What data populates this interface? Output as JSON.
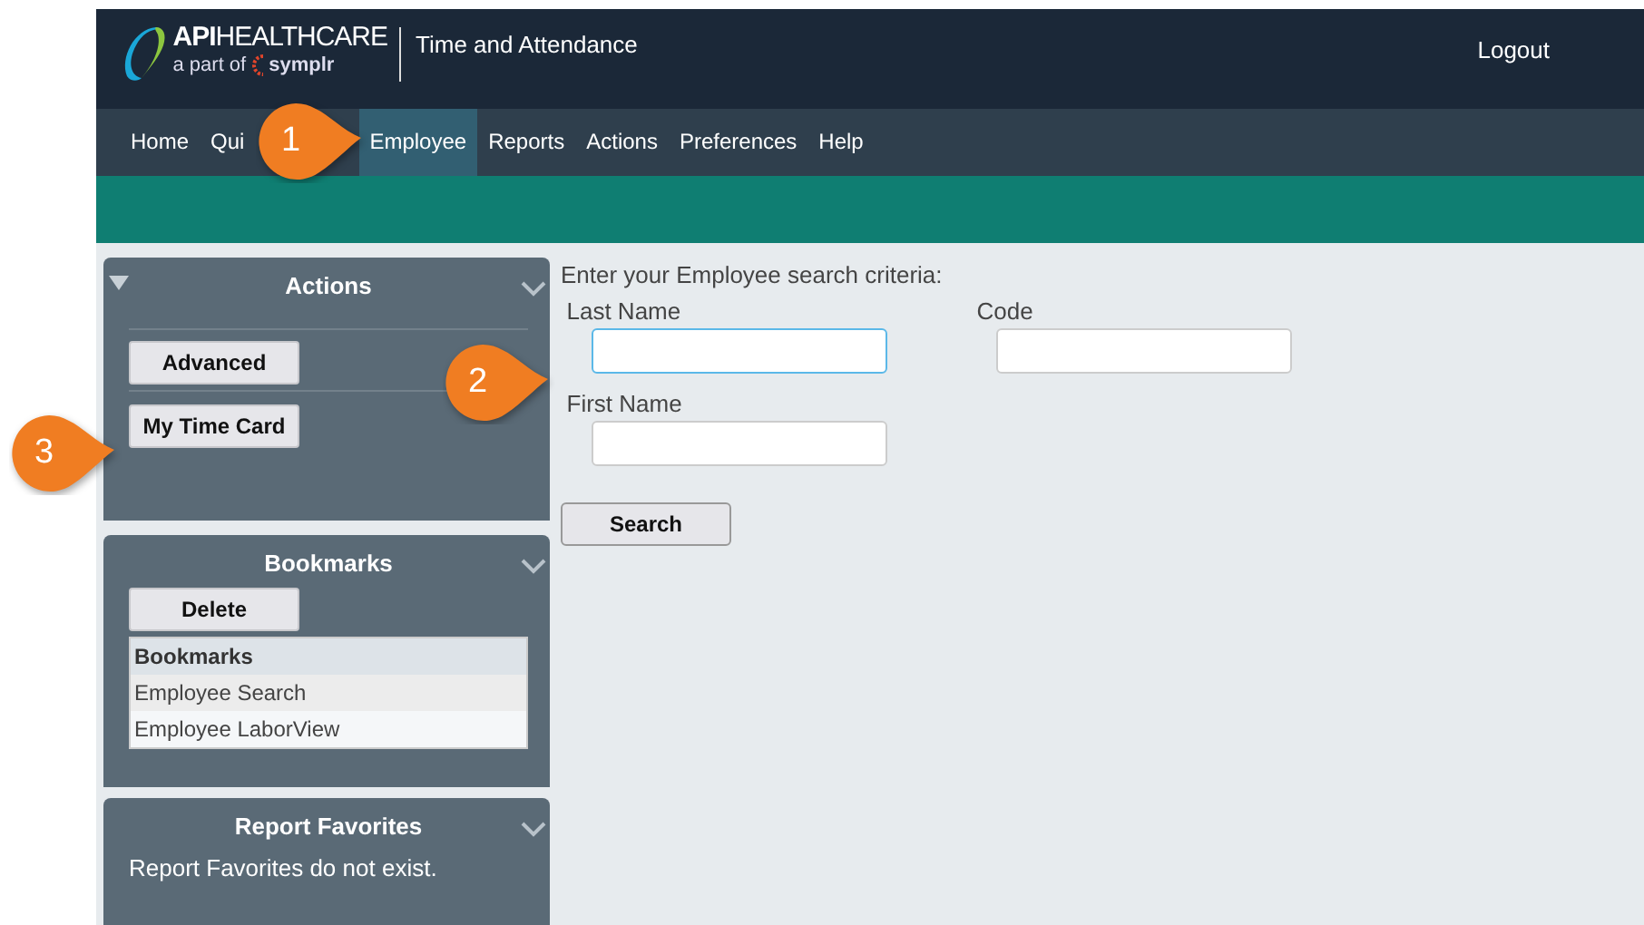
{
  "header": {
    "logo": {
      "brand": "API",
      "brand_rest": "HEALTHCARE",
      "tagline": "a part of",
      "partner": "symplr"
    },
    "app_title": "Time and Attendance",
    "logout": "Logout"
  },
  "nav": [
    {
      "label": "Home",
      "selected": false
    },
    {
      "label": "Qui",
      "selected": false
    },
    {
      "label": "Employee",
      "selected": true
    },
    {
      "label": "Reports",
      "selected": false
    },
    {
      "label": "Actions",
      "selected": false
    },
    {
      "label": "Preferences",
      "selected": false
    },
    {
      "label": "Help",
      "selected": false
    }
  ],
  "sidebar": {
    "actions": {
      "title": "Actions",
      "expanded": true,
      "buttons": [
        "Advanced",
        "My Time Card"
      ]
    },
    "bookmarks": {
      "title": "Bookmarks",
      "button": "Delete",
      "list_header": "Bookmarks",
      "items": [
        "Employee Search",
        "Employee LaborView"
      ]
    },
    "report_favorites": {
      "title": "Report Favorites",
      "message": "Report Favorites do not exist."
    }
  },
  "search_form": {
    "instruction": "Enter your Employee search criteria:",
    "fields": [
      {
        "label": "Last Name",
        "focused": true
      },
      {
        "label": "Code",
        "focused": false
      },
      {
        "label": "First Name",
        "focused": false
      }
    ],
    "button": "Search"
  },
  "callouts": [
    "1",
    "2",
    "3"
  ]
}
